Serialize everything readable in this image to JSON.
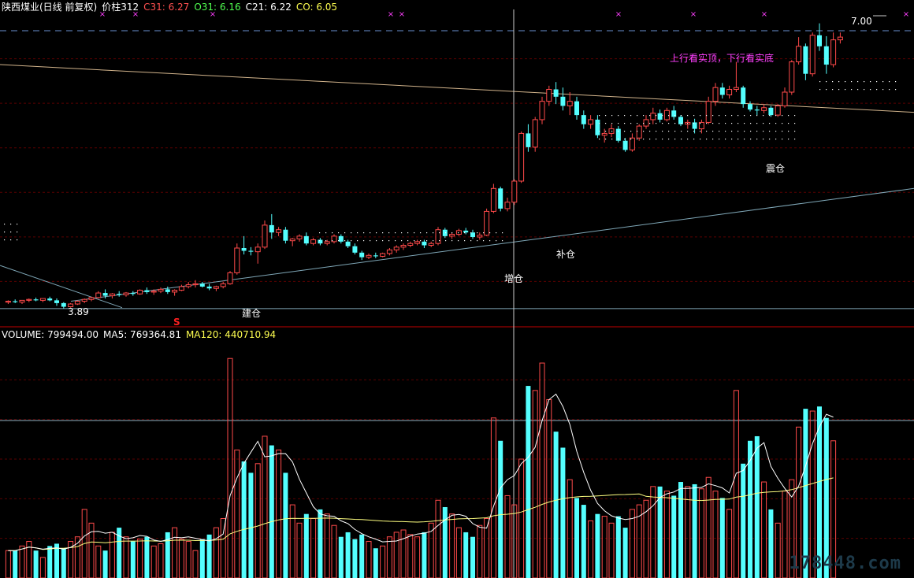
{
  "header": {
    "title": "陕西煤业(日线 前复权)",
    "price_label": "价柱312",
    "c31": "C31: 6.27",
    "o31": "O31: 6.16",
    "c21": "C21: 6.22",
    "co": "CO: 6.05"
  },
  "volume_header": {
    "volume": "VOLUME: 799494.00",
    "ma5": "MA5: 769364.81",
    "ma120": "MA120: 440710.94"
  },
  "annotations": {
    "jiancang": "建仓",
    "zengcang": "增仓",
    "bucang": "补仓",
    "zhencang": "震仓",
    "top_note": "上行看实顶，下行看实底",
    "low_price": "3.89",
    "high_price": "7.00",
    "signal": "S"
  },
  "watermark": "178448.com",
  "colors": {
    "up": "#ff4a4a",
    "down": "#54ffff",
    "ma5": "#ffffff",
    "ma120": "#ffff80",
    "trend": "#7fa7b7",
    "resistance": "#d2b48c",
    "dashed": "#6a8fd0",
    "magenta": "#ff40ff",
    "header_c31": "#ff5050",
    "header_o31": "#50ff50",
    "header_c21": "#ffffff",
    "header_co": "#ffff50"
  },
  "chart_data": {
    "type": "candlestick",
    "title": "陕西煤业(日线 前复权)",
    "price_range": [
      3.7,
      7.1
    ],
    "levels": {
      "low": 3.89,
      "high": 7.0
    },
    "candles": [
      [
        3.96,
        3.98,
        3.94,
        3.97
      ],
      [
        3.97,
        3.99,
        3.95,
        3.96
      ],
      [
        3.96,
        3.98,
        3.94,
        3.98
      ],
      [
        3.98,
        4.0,
        3.96,
        3.99
      ],
      [
        3.99,
        4.01,
        3.97,
        3.98
      ],
      [
        3.98,
        4.0,
        3.96,
        4.0
      ],
      [
        4.0,
        4.02,
        3.97,
        3.98
      ],
      [
        3.98,
        4.0,
        3.92,
        3.95
      ],
      [
        3.95,
        3.96,
        3.89,
        3.91
      ],
      [
        3.91,
        3.95,
        3.9,
        3.94
      ],
      [
        3.94,
        3.98,
        3.93,
        3.97
      ],
      [
        3.97,
        4.0,
        3.95,
        3.99
      ],
      [
        3.99,
        4.02,
        3.97,
        4.01
      ],
      [
        4.01,
        4.08,
        4.0,
        4.06
      ],
      [
        4.06,
        4.1,
        4.0,
        4.03
      ],
      [
        4.03,
        4.06,
        4.0,
        4.05
      ],
      [
        4.05,
        4.08,
        4.02,
        4.04
      ],
      [
        4.04,
        4.07,
        4.02,
        4.06
      ],
      [
        4.06,
        4.08,
        4.03,
        4.05
      ],
      [
        4.05,
        4.1,
        4.04,
        4.09
      ],
      [
        4.09,
        4.12,
        4.05,
        4.07
      ],
      [
        4.07,
        4.1,
        4.04,
        4.08
      ],
      [
        4.08,
        4.12,
        4.06,
        4.1
      ],
      [
        4.1,
        4.13,
        4.05,
        4.07
      ],
      [
        4.07,
        4.1,
        4.03,
        4.09
      ],
      [
        4.09,
        4.15,
        4.08,
        4.13
      ],
      [
        4.13,
        4.18,
        4.11,
        4.15
      ],
      [
        4.15,
        4.2,
        4.12,
        4.16
      ],
      [
        4.16,
        4.18,
        4.12,
        4.13
      ],
      [
        4.13,
        4.16,
        4.09,
        4.11
      ],
      [
        4.11,
        4.14,
        4.08,
        4.13
      ],
      [
        4.13,
        4.18,
        4.11,
        4.16
      ],
      [
        4.16,
        4.3,
        4.15,
        4.28
      ],
      [
        4.28,
        4.6,
        4.26,
        4.55
      ],
      [
        4.55,
        4.68,
        4.48,
        4.52
      ],
      [
        4.52,
        4.56,
        4.47,
        4.51
      ],
      [
        4.51,
        4.6,
        4.38,
        4.56
      ],
      [
        4.56,
        4.85,
        4.54,
        4.8
      ],
      [
        4.8,
        4.92,
        4.65,
        4.72
      ],
      [
        4.72,
        4.78,
        4.68,
        4.75
      ],
      [
        4.75,
        4.78,
        4.6,
        4.63
      ],
      [
        4.63,
        4.66,
        4.57,
        4.65
      ],
      [
        4.65,
        4.7,
        4.62,
        4.68
      ],
      [
        4.68,
        4.72,
        4.58,
        4.6
      ],
      [
        4.6,
        4.66,
        4.58,
        4.64
      ],
      [
        4.64,
        4.66,
        4.58,
        4.6
      ],
      [
        4.6,
        4.64,
        4.58,
        4.62
      ],
      [
        4.62,
        4.7,
        4.6,
        4.68
      ],
      [
        4.68,
        4.7,
        4.6,
        4.62
      ],
      [
        4.62,
        4.64,
        4.55,
        4.57
      ],
      [
        4.57,
        4.6,
        4.48,
        4.5
      ],
      [
        4.5,
        4.52,
        4.42,
        4.45
      ],
      [
        4.45,
        4.49,
        4.43,
        4.47
      ],
      [
        4.47,
        4.5,
        4.44,
        4.46
      ],
      [
        4.46,
        4.5,
        4.45,
        4.49
      ],
      [
        4.49,
        4.55,
        4.47,
        4.53
      ],
      [
        4.53,
        4.58,
        4.5,
        4.56
      ],
      [
        4.56,
        4.6,
        4.53,
        4.58
      ],
      [
        4.58,
        4.62,
        4.56,
        4.6
      ],
      [
        4.6,
        4.64,
        4.58,
        4.62
      ],
      [
        4.62,
        4.64,
        4.55,
        4.58
      ],
      [
        4.58,
        4.62,
        4.56,
        4.6
      ],
      [
        4.6,
        4.78,
        4.58,
        4.75
      ],
      [
        4.75,
        4.77,
        4.66,
        4.68
      ],
      [
        4.68,
        4.72,
        4.65,
        4.7
      ],
      [
        4.7,
        4.76,
        4.68,
        4.74
      ],
      [
        4.74,
        4.77,
        4.7,
        4.72
      ],
      [
        4.72,
        4.75,
        4.65,
        4.67
      ],
      [
        4.67,
        4.72,
        4.64,
        4.69
      ],
      [
        4.69,
        4.98,
        4.68,
        4.95
      ],
      [
        4.95,
        5.25,
        4.93,
        5.2
      ],
      [
        5.2,
        5.22,
        4.95,
        4.98
      ],
      [
        4.98,
        5.1,
        4.95,
        5.05
      ],
      [
        5.05,
        5.3,
        5.02,
        5.28
      ],
      [
        5.28,
        5.82,
        5.26,
        5.8
      ],
      [
        5.8,
        5.9,
        5.6,
        5.65
      ],
      [
        5.65,
        5.98,
        5.6,
        5.95
      ],
      [
        5.95,
        6.2,
        5.9,
        6.15
      ],
      [
        6.15,
        6.32,
        6.1,
        6.28
      ],
      [
        6.28,
        6.36,
        6.12,
        6.2
      ],
      [
        6.2,
        6.3,
        6.05,
        6.1
      ],
      [
        6.1,
        6.25,
        6.0,
        6.15
      ],
      [
        6.15,
        6.2,
        5.95,
        6.0
      ],
      [
        6.0,
        6.05,
        5.85,
        5.9
      ],
      [
        5.9,
        6.0,
        5.85,
        5.95
      ],
      [
        5.95,
        6.0,
        5.75,
        5.78
      ],
      [
        5.78,
        5.85,
        5.7,
        5.8
      ],
      [
        5.8,
        5.9,
        5.76,
        5.85
      ],
      [
        5.85,
        5.88,
        5.7,
        5.72
      ],
      [
        5.72,
        5.75,
        5.6,
        5.62
      ],
      [
        5.62,
        5.8,
        5.6,
        5.75
      ],
      [
        5.75,
        5.9,
        5.72,
        5.88
      ],
      [
        5.88,
        6.0,
        5.85,
        5.95
      ],
      [
        5.95,
        6.08,
        5.9,
        6.02
      ],
      [
        6.02,
        6.06,
        5.92,
        5.95
      ],
      [
        5.95,
        6.08,
        5.93,
        6.05
      ],
      [
        6.05,
        6.1,
        5.95,
        5.98
      ],
      [
        5.98,
        6.0,
        5.88,
        5.9
      ],
      [
        5.9,
        5.95,
        5.85,
        5.92
      ],
      [
        5.92,
        5.96,
        5.8,
        5.85
      ],
      [
        5.85,
        5.95,
        5.8,
        5.92
      ],
      [
        5.92,
        6.2,
        5.9,
        6.15
      ],
      [
        6.15,
        6.35,
        6.1,
        6.3
      ],
      [
        6.3,
        6.35,
        6.18,
        6.22
      ],
      [
        6.22,
        6.32,
        6.18,
        6.28
      ],
      [
        6.28,
        6.58,
        6.25,
        6.3
      ],
      [
        6.3,
        6.32,
        6.08,
        6.12
      ],
      [
        6.12,
        6.15,
        6.04,
        6.06
      ],
      [
        6.06,
        6.1,
        6.0,
        6.05
      ],
      [
        6.05,
        6.12,
        6.02,
        6.08
      ],
      [
        6.08,
        6.1,
        5.98,
        6.0
      ],
      [
        6.0,
        6.12,
        5.98,
        6.1
      ],
      [
        6.1,
        6.3,
        6.08,
        6.25
      ],
      [
        6.25,
        6.6,
        6.22,
        6.58
      ],
      [
        6.58,
        6.85,
        6.55,
        6.75
      ],
      [
        6.75,
        6.78,
        6.38,
        6.45
      ],
      [
        6.45,
        6.9,
        6.42,
        6.87
      ],
      [
        6.87,
        7.0,
        6.7,
        6.75
      ],
      [
        6.75,
        6.86,
        6.45,
        6.55
      ],
      [
        6.55,
        6.9,
        6.52,
        6.82
      ],
      [
        6.82,
        6.9,
        6.78,
        6.85
      ]
    ],
    "volume_series": [
      {
        "name": "VOLUME",
        "current": 799494.0
      },
      {
        "name": "MA5",
        "current": 769364.81
      },
      {
        "name": "MA120",
        "current": 440710.94
      }
    ],
    "volume": [
      60,
      60,
      70,
      80,
      60,
      45,
      70,
      75,
      65,
      80,
      90,
      150,
      120,
      70,
      60,
      100,
      110,
      90,
      80,
      85,
      90,
      70,
      75,
      100,
      110,
      85,
      80,
      60,
      85,
      95,
      110,
      130,
      480,
      280,
      255,
      230,
      250,
      310,
      290,
      280,
      230,
      160,
      120,
      140,
      130,
      150,
      140,
      115,
      90,
      100,
      85,
      95,
      80,
      65,
      70,
      90,
      100,
      105,
      95,
      90,
      100,
      120,
      170,
      155,
      140,
      110,
      100,
      90,
      115,
      130,
      350,
      300,
      180,
      160,
      260,
      420,
      410,
      470,
      390,
      320,
      285,
      215,
      175,
      160,
      125,
      140,
      135,
      120,
      135,
      110,
      150,
      160,
      170,
      200,
      200,
      190,
      180,
      210,
      200,
      205,
      195,
      220,
      190,
      175,
      150,
      410,
      250,
      300,
      310,
      210,
      150,
      120,
      190,
      215,
      330,
      370,
      365,
      375,
      350,
      300
    ]
  }
}
